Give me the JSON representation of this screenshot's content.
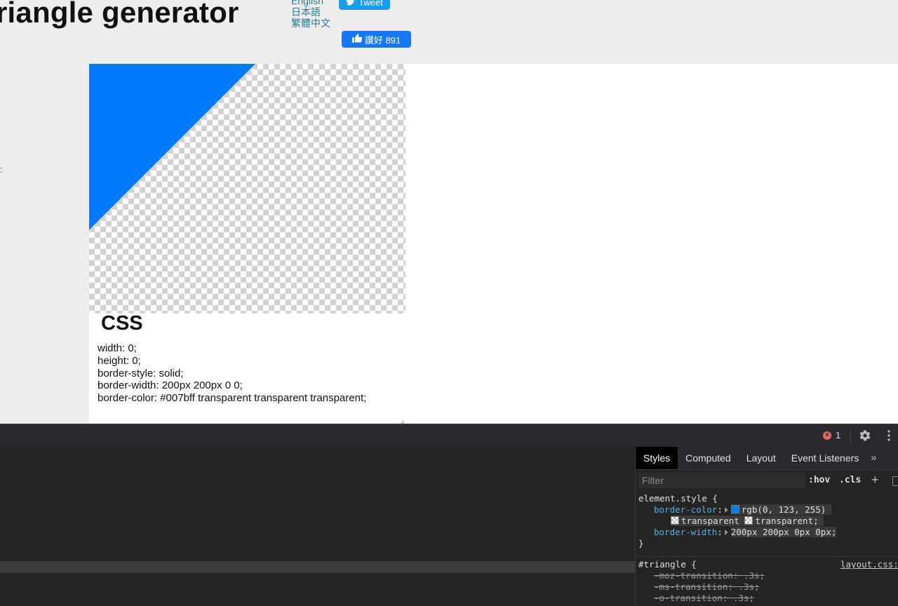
{
  "page": {
    "title": "riangle generator",
    "languages": [
      "English",
      "日本語",
      "繁體中文"
    ],
    "tweet_label": "Tweet",
    "fb_like_label": "讚好 891",
    "left_glyph": ":"
  },
  "colors": {
    "triangle": "#007bff",
    "devtools_bg": "#242424",
    "tweet_blue": "#1d9bf0",
    "facebook_blue": "#1877f2"
  },
  "css_panel": {
    "heading": "CSS",
    "code": "width: 0;\nheight: 0;\nborder-style: solid;\nborder-width: 200px 200px 0 0;\nborder-color: #007bff transparent transparent transparent;"
  },
  "devtools": {
    "error_count": "1",
    "tabs": [
      "Styles",
      "Computed",
      "Layout",
      "Event Listeners"
    ],
    "more_tabs": "»",
    "filter_placeholder": "Filter",
    "hov_label": ":hov",
    "cls_label": ".cls",
    "add_label": "+",
    "element_style": {
      "selector": "element.style {",
      "border_color_prop": "border-color",
      "border_color_val1": "rgb(0, 123, 255)",
      "border_color_val2": "transparent",
      "border_color_val3": "transparent;",
      "border_width_prop": "border-width",
      "border_width_val": "200px 200px 0px 0px;",
      "close": "}"
    },
    "triangle_rule": {
      "selector": "#triangle {",
      "source": "layout.css:",
      "lines": [
        "-moz-transition: .3s;",
        "-ms-transition: .3s;",
        "-o-transition: .3s;"
      ]
    }
  }
}
